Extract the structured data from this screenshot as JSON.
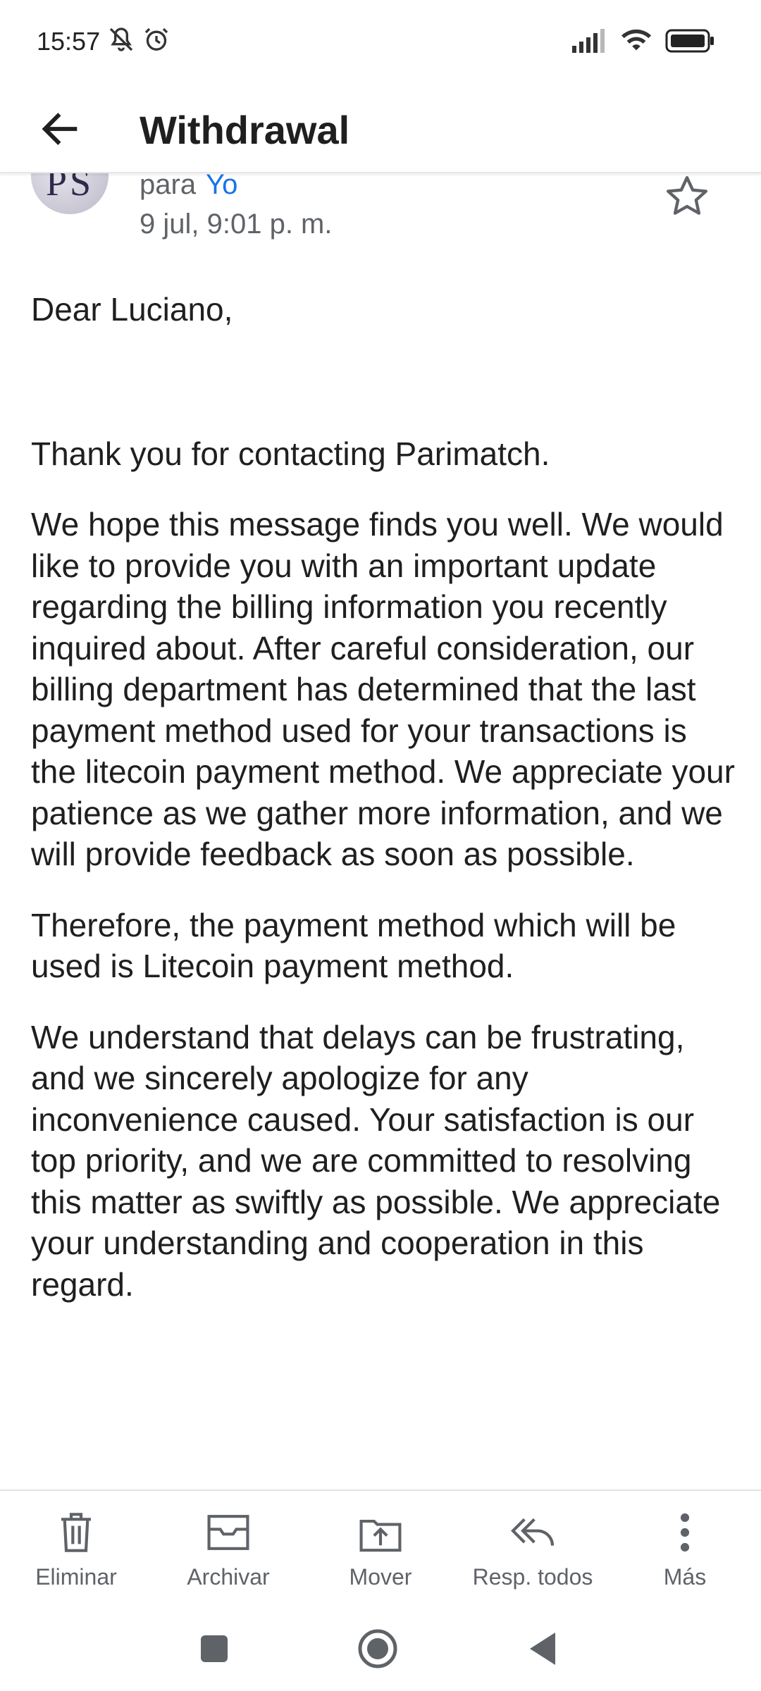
{
  "status_bar": {
    "time": "15:57",
    "icons": [
      "bell-off-icon",
      "alarm-icon",
      "signal-icon",
      "wifi-icon",
      "battery-icon"
    ]
  },
  "header": {
    "title": "Withdrawal",
    "back_icon": "arrow-back-icon"
  },
  "sender": {
    "avatar_text": "PS",
    "to_label": "para",
    "to_name": "Yo",
    "date": "9 jul, 9:01 p. m.",
    "star_icon": "star-outline-icon"
  },
  "email": {
    "greeting": "Dear Luciano,",
    "paragraphs": [
      "Thank you for contacting Parimatch.",
      "We hope this message finds you well. We would like to provide you with an important update regarding the billing information you recently inquired about. After careful consideration, our billing department has determined that the last payment method used for your transactions is the litecoin payment method. We appreciate your patience as we gather more information, and we will provide feedback as soon as possible.",
      "Therefore, the payment method which will be used is Litecoin payment method.",
      "We understand that delays can be frustrating, and we sincerely apologize for any inconvenience caused. Your satisfaction is our top priority, and we are committed to resolving this matter as swiftly as possible. We appreciate your understanding and cooperation in this regard."
    ]
  },
  "actions": [
    {
      "label": "Eliminar",
      "icon": "trash-icon"
    },
    {
      "label": "Archivar",
      "icon": "archive-icon"
    },
    {
      "label": "Mover",
      "icon": "move-icon"
    },
    {
      "label": "Resp. todos",
      "icon": "reply-all-icon"
    },
    {
      "label": "Más",
      "icon": "more-vert-icon"
    }
  ],
  "nav": {
    "icons": [
      "recents-square-icon",
      "home-circle-icon",
      "back-triangle-icon"
    ]
  },
  "colors": {
    "accent_link": "#1a73e8",
    "text_primary": "#1f1f1f",
    "text_secondary": "#5f6368"
  }
}
